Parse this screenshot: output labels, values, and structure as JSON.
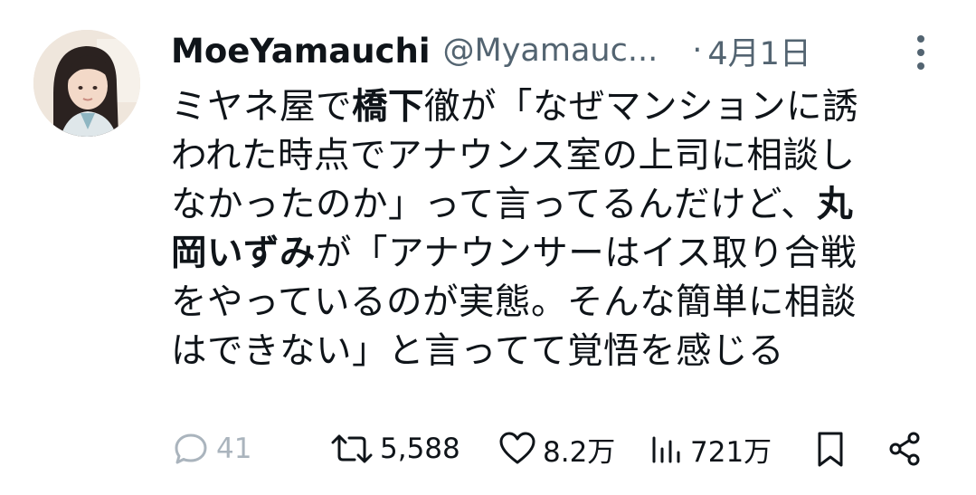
{
  "tweet": {
    "author_name": "MoeYamauchi",
    "author_handle": "@Myamauc...",
    "separator": "·",
    "date": "4月1日",
    "lines": [
      [
        "ミヤネ屋で",
        "橋下",
        "徹が「なぜマンションに誘"
      ],
      [
        "われた時点でアナウンス室の上司に相談し",
        "",
        ""
      ],
      [
        "なかったのか」って言ってるんだけど、",
        "丸",
        ""
      ],
      [
        "",
        "岡いずみ",
        "が「アナウンサーはイス取り合戦"
      ],
      [
        "をやっているのが実態。そんな簡単に相談",
        "",
        ""
      ],
      [
        "はできない」と言ってて覚悟を感じる",
        "",
        ""
      ]
    ]
  },
  "actions": {
    "reply_count": "41",
    "retweet_count": "5,588",
    "like_count": "8.2万",
    "view_count": "721万"
  },
  "icons": {
    "more": "more-vertical-icon",
    "reply": "reply-bubble-icon",
    "retweet": "retweet-icon",
    "like": "heart-icon",
    "views": "views-bars-icon",
    "bookmark": "bookmark-icon",
    "share": "share-icon"
  },
  "colors": {
    "text": "#0f1419",
    "muted": "#536471",
    "reply_muted": "#aab4bd"
  }
}
